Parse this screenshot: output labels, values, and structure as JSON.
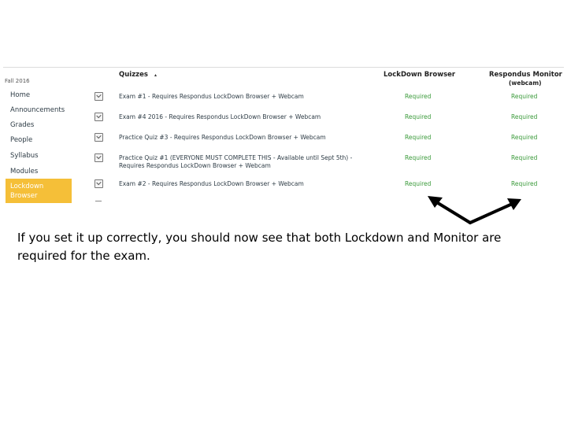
{
  "course_label": "Fall 2016",
  "nav": {
    "items": [
      "Home",
      "Announcements",
      "Grades",
      "People",
      "Syllabus",
      "Modules"
    ],
    "active": [
      "Lockdown",
      "Browser"
    ]
  },
  "table": {
    "col_quizzes": "Quizzes",
    "sort_indicator": "▴",
    "col_lockdown": "LockDown Browser",
    "col_monitor": "Respondus Monitor",
    "col_monitor_sub": "(webcam)",
    "rows": [
      {
        "title": "Exam #1 - Requires Respondus LockDown Browser + Webcam",
        "lockdown": "Required",
        "monitor": "Required"
      },
      {
        "title": "Exam #4 2016 - Requires Respondus LockDown Browser + Webcam",
        "lockdown": "Required",
        "monitor": "Required"
      },
      {
        "title": "Practice Quiz #3 - Requires Respondus LockDown Browser + Webcam",
        "lockdown": "Required",
        "monitor": "Required"
      },
      {
        "title": "Practice Quiz #1 (EVERYONE MUST COMPLETE THIS - Available until Sept 5th) -",
        "title2": "Requires Respondus LockDown Browser + Webcam",
        "lockdown": "Required",
        "monitor": "Required"
      },
      {
        "title": "Exam #2 - Requires Respondus LockDown Browser + Webcam",
        "lockdown": "Required",
        "monitor": "Required"
      }
    ]
  },
  "caption": "If you set it up correctly, you should now see that both Lockdown and Monitor are required for the exam.",
  "colors": {
    "required": "#3a9a3a",
    "active_nav": "#f5bf38",
    "arrow": "#000000"
  }
}
